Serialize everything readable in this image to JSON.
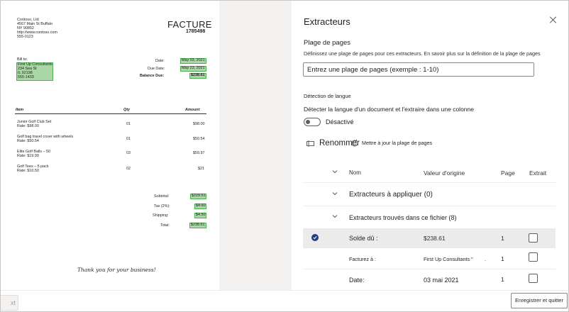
{
  "invoice": {
    "company_lines": [
      "Contoso, Ltd",
      "4567 Main St Buffalo",
      "NY 90852",
      "http://www.contoso.com",
      "555-0123"
    ],
    "title": "FACTURE",
    "number": "1785498",
    "bill_to_label": "Bill to:",
    "bill_to_lines": [
      "First Up Consultants",
      "234 Sea St",
      "IL 92198",
      "555-1433"
    ],
    "date_label": "Date:",
    "date_value": "May 03, 2021",
    "due_label": "Due Date:",
    "due_value": "May 23, 2021",
    "balance_label": "Balance Due:",
    "balance_value": "$238.61",
    "col_item": "Item",
    "col_qty": "Qty",
    "col_amount": "Amount",
    "items": [
      {
        "name": "Junior Golf Club Set",
        "rate": "Rate: $98.00",
        "qty": "01",
        "amount": "$98.00"
      },
      {
        "name": "Golf bag travel cover with wheels",
        "rate": "Rate: $50.54",
        "qty": "01",
        "amount": "$50.54"
      },
      {
        "name": "Elite Golf Balls – 50",
        "rate": "Rate: $19.99",
        "qty": "03",
        "amount": "$59.97"
      },
      {
        "name": "Golf Tees – 5 pack",
        "rate": "Rate: $10.50",
        "qty": "02",
        "amount": "$21"
      }
    ],
    "subtotal_label": "Subtotal:",
    "subtotal_value": "$229.51",
    "tax_label": "Tax (2%):",
    "tax_value": "$4.60",
    "shipping_label": "Shipping:",
    "shipping_value": "$4.50",
    "total_label": "Total:",
    "total_value": "$238.61",
    "thanks": "Thank you for your business!"
  },
  "panel": {
    "title": "Extracteurs",
    "page_range_heading": "Plage de pages",
    "page_range_desc": "Définissez une plage de pages pour ces extracteurs. En savoir plus sur la définition de la plage de pages",
    "page_range_placeholder": "Entrez une plage de pages (exemple : 1-10)",
    "language_heading": "Détection de langue",
    "language_desc": "Détecter la langue d'un document et l'extraire dans une colonne",
    "toggle_state": "Désactivé",
    "rename_label": "Renommer",
    "update_range_label": "Mettre à jour la plage de pages",
    "columns": {
      "name": "Nom",
      "original": "Valeur d'origine",
      "page": "Page",
      "extract": "Extrait"
    },
    "group_apply": "Extracteurs à appliquer (0)",
    "group_found": "Extracteurs trouvés dans ce fichier (8)",
    "rows": [
      {
        "name": "Solde dû :",
        "original": "$238.61",
        "page": "1"
      },
      {
        "name": "Facturez à :",
        "original": "First Up Consultants \"",
        "extra": ".",
        "page": "1"
      },
      {
        "name": "Date:",
        "original": "03 mai 2021",
        "page": "1"
      }
    ]
  },
  "footer": {
    "left_button": "xt",
    "save_button": "Enregistrer et quitter"
  },
  "colors": {
    "highlight": "#a9d7a6",
    "check": "#1f3d80",
    "panel_bg": "#ffffff",
    "preview_bg": "#f3f2f1"
  }
}
